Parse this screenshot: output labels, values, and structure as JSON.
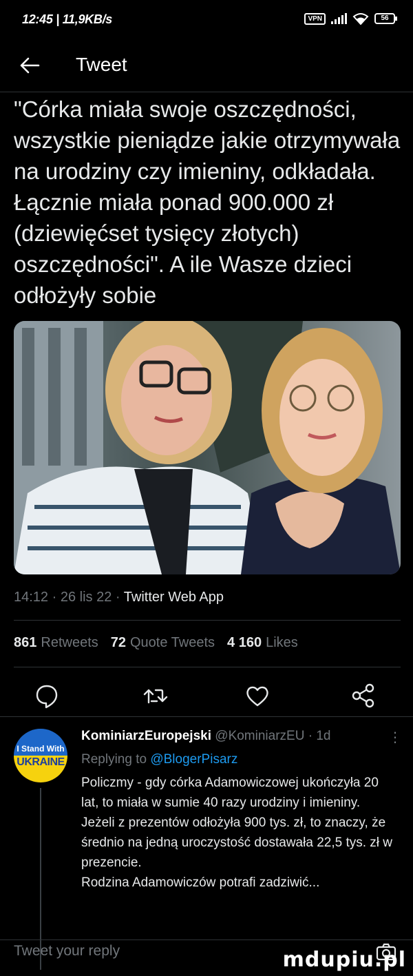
{
  "status_bar": {
    "time_speed": "12:45 | 11,9KB/s",
    "vpn_label": "VPN",
    "battery": "56"
  },
  "header": {
    "title": "Tweet"
  },
  "tweet": {
    "text": "\"Córka miała swoje oszczędności, wszystkie pieniądze jakie otrzymywała na urodziny czy imieniny, odkładała. Łącznie miała ponad 900.000 zł (dziewięćset tysięcy złotych) oszczędności\". A ile Wasze dzieci odłożyły sobie",
    "time": "14:12",
    "date": "26 lis 22",
    "source": "Twitter Web App",
    "retweets_count": "861",
    "retweets_label": "Retweets",
    "quotes_count": "72",
    "quotes_label": "Quote Tweets",
    "likes_count": "4 160",
    "likes_label": "Likes"
  },
  "reply": {
    "avatar_line1": "I Stand With",
    "avatar_line2": "UKRAINE",
    "name": "KominiarzEuropejski",
    "handle": "@KominiarzEU",
    "age": "1d",
    "replying_prefix": "Replying to",
    "replying_to": "@BlogerPisarz",
    "body": "Policzmy - gdy córka Adamowiczowej ukończyła 20 lat, to miała w sumie 40 razy urodziny i imieniny.\nJeżeli z prezentów odłożyła 900 tys. zł, to znaczy, że średnio na jedną uroczystość dostawała 22,5 tys. zł w prezencie.\nRodzina Adamowiczów potrafi zadziwić..."
  },
  "compose": {
    "placeholder": "Tweet your reply"
  },
  "watermark": "mdupiu.pl",
  "icons": {
    "back": "arrow-left-icon",
    "reply": "comment-icon",
    "retweet": "retweet-icon",
    "like": "heart-icon",
    "share": "share-icon",
    "camera": "camera-icon"
  },
  "colors": {
    "background": "#000000",
    "text": "#e7e9ea",
    "muted": "#71767b",
    "link": "#1d9bf0"
  }
}
